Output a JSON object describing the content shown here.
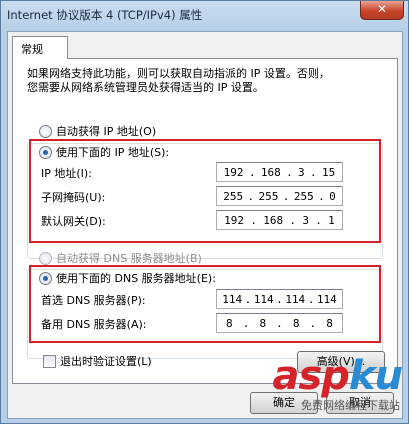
{
  "window": {
    "title": "Internet 协议版本 4 (TCP/IPv4) 属性",
    "close_glyph": "✕"
  },
  "tab": {
    "label": "常规"
  },
  "description": {
    "line1": "如果网络支持此功能，则可以获取自动指派的 IP 设置。否则，",
    "line2": "您需要从网络系统管理员处获得适当的 IP 设置。"
  },
  "ip_section": {
    "auto_label": "自动获得 IP 地址(O)",
    "manual_label": "使用下面的 IP 地址(S):",
    "fields": [
      {
        "label": "IP 地址(I):",
        "octets": [
          "192",
          "168",
          "3",
          "15"
        ]
      },
      {
        "label": "子网掩码(U):",
        "octets": [
          "255",
          "255",
          "255",
          "0"
        ]
      },
      {
        "label": "默认网关(D):",
        "octets": [
          "192",
          "168",
          "3",
          "1"
        ]
      }
    ]
  },
  "dns_section": {
    "auto_label": "自动获得 DNS 服务器地址(B)",
    "manual_label": "使用下面的 DNS 服务器地址(E):",
    "fields": [
      {
        "label": "首选 DNS 服务器(P):",
        "octets": [
          "114",
          "114",
          "114",
          "114"
        ]
      },
      {
        "label": "备用 DNS 服务器(A):",
        "octets": [
          "8",
          "8",
          "8",
          "8"
        ]
      }
    ]
  },
  "validate_label": "退出时验证设置(L)",
  "advanced_label": "高级(V)...",
  "ok_label": "确定",
  "cancel_label": "取消",
  "watermark": {
    "brand_a": "asp",
    "brand_b": "ku",
    "sub": "免费网络编程下载站"
  },
  "colors": {
    "highlight_box": "#d3232a",
    "radio_dot": "#2364b8"
  }
}
